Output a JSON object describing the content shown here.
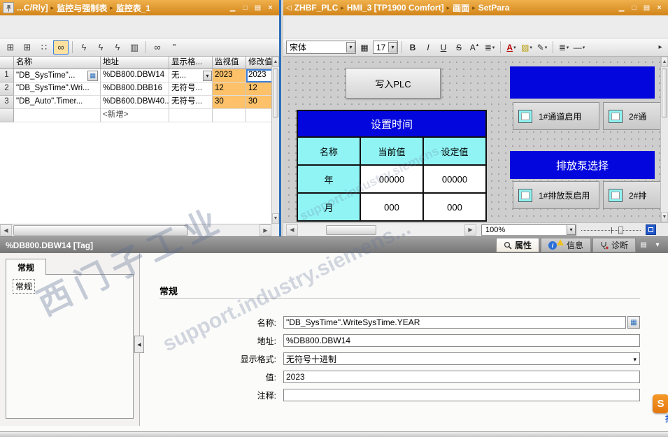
{
  "ui": {
    "sep": "▸",
    "back": "◁",
    "caret": "▾",
    "win": [
      "▁",
      "□",
      "▤",
      "×"
    ],
    "left_arrow": "◀",
    "right_arrow": "▶",
    "up_arrow": "▲",
    "down_arrow": "▼",
    "collapse": "◀",
    "browse_icon": "▦",
    "info_i": "i"
  },
  "left": {
    "titlebar": {
      "crumbs": [
        "...C/Rly]",
        "监控与强制表",
        "监控表_1"
      ]
    },
    "toolbar": {
      "icons": [
        "⊞",
        "⊞",
        "∷",
        "∞",
        "ϟ",
        "ϟ",
        "ϟ",
        "▥",
        "∞",
        "”"
      ]
    },
    "table": {
      "headers": [
        "名称",
        "地址",
        "显示格...",
        "监视值",
        "修改值"
      ],
      "rows": [
        {
          "num": "1",
          "name": "\"DB_SysTime\"...",
          "addr": "%DB800.DBW14",
          "fmt": "无...",
          "mon": "2023",
          "mod": "2023"
        },
        {
          "num": "2",
          "name": "\"DB_SysTime\".Wri...",
          "addr": "%DB800.DBB16",
          "fmt": "无符号...",
          "mon": "12",
          "mod": "12"
        },
        {
          "num": "3",
          "name": "\"DB_Auto\".Timer...",
          "addr": "%DB600.DBW40...",
          "fmt": "无符号...",
          "mon": "30",
          "mod": "30"
        },
        {
          "num": "",
          "name": "",
          "addr": "<新增>",
          "fmt": "",
          "mon": "",
          "mod": ""
        }
      ]
    }
  },
  "right": {
    "titlebar": {
      "crumbs": [
        "ZHBF_PLC",
        "HMI_3 [TP1900 Comfort]",
        "画面",
        "SetPara"
      ]
    },
    "fmt": {
      "font": "宋体",
      "size": "17",
      "grid": "▦",
      "b": "B",
      "i": "I",
      "u": "U",
      "s": "S",
      "sup": "A",
      "supmark": "▴",
      "align": "≣",
      "color": "A",
      "hl": "▨",
      "pen": "✎",
      "lines": "≣",
      "dash": "—",
      "more": "▸"
    },
    "canvas": {
      "write_btn": "写入PLC",
      "ch1": "1#通道启用",
      "ch2": "2#通",
      "time_table": {
        "title": "设置时间",
        "headers": [
          "名称",
          "当前值",
          "设定值"
        ],
        "rows": [
          {
            "label": "年",
            "current": "00000",
            "set": "00000"
          },
          {
            "label": "月",
            "current": "000",
            "set": "000"
          }
        ]
      },
      "pump_title": "排放泵选择",
      "p1": "1#排放泵启用",
      "p2": "2#排"
    },
    "zoom": "100%"
  },
  "props": {
    "title": "%DB800.DBW14 [Tag]",
    "tabs": {
      "properties": "属性",
      "info": "信息",
      "diag": "诊断"
    },
    "side_tab": "常规",
    "side_item": "常规",
    "heading": "常规",
    "form": {
      "name_label": "名称:",
      "name_value": "\"DB_SysTime\".WriteSysTime.YEAR",
      "addr_label": "地址:",
      "addr_value": "%DB800.DBW14",
      "fmt_label": "显示格式:",
      "fmt_value": "无符号十进制",
      "val_label": "值:",
      "val_value": "2023",
      "comment_label": "注释:",
      "comment_value": ""
    }
  },
  "watermark": {
    "l1": "西门子工业",
    "l2": "support.industry.siemens...",
    "l3": "support.industry.siemens..."
  },
  "badge": {
    "letter": "S",
    "partial": "找"
  }
}
